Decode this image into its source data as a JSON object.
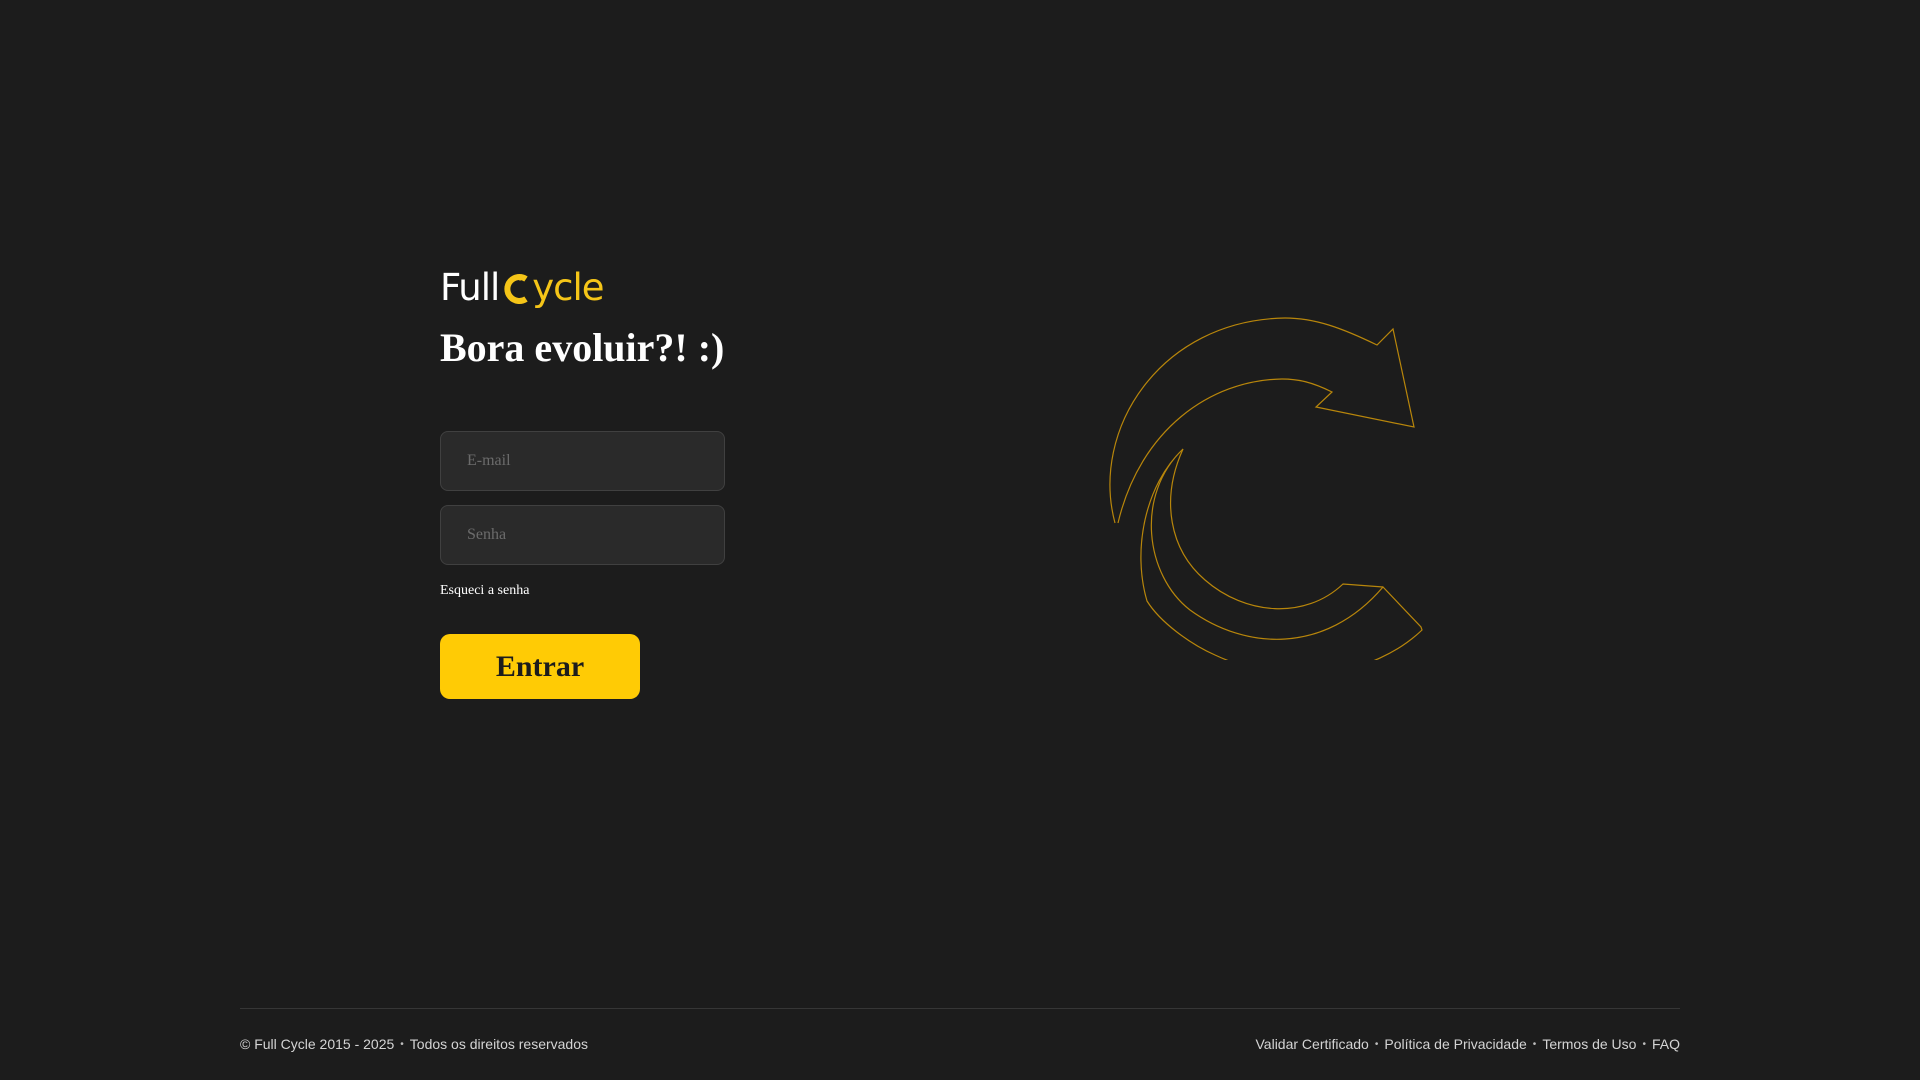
{
  "brand": {
    "logo_part_1": "Full",
    "logo_part_2": "ycle",
    "accent_color": "#ffcb05"
  },
  "login": {
    "headline": "Bora evoluir?! :)",
    "email_placeholder": "E-mail",
    "password_placeholder": "Senha",
    "forgot_password": "Esqueci a senha",
    "submit_label": "Entrar"
  },
  "illustration": {
    "icon": "refresh-arrow-icon",
    "stroke_color": "#b8860b"
  },
  "footer": {
    "copyright": "© Full Cycle 2015 - 2025",
    "rights": "Todos os direitos reservados",
    "links": [
      {
        "label": "Validar Certificado"
      },
      {
        "label": "Política de Privacidade"
      },
      {
        "label": "Termos de Uso"
      },
      {
        "label": "FAQ"
      }
    ]
  }
}
